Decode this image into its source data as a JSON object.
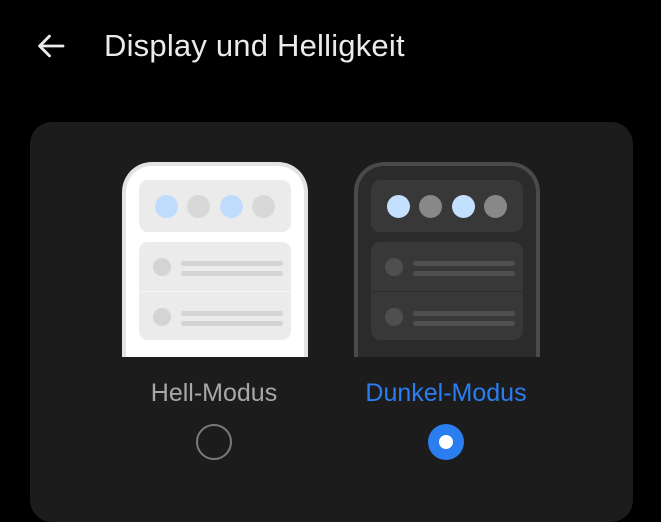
{
  "header": {
    "title": "Display und Helligkeit",
    "back_icon": "arrow-left-icon"
  },
  "theme_options": [
    {
      "label": "Hell-Modus",
      "selected": false,
      "preview": "light"
    },
    {
      "label": "Dunkel-Modus",
      "selected": true,
      "preview": "dark"
    }
  ],
  "colors": {
    "background": "#000000",
    "card": "#1c1c1c",
    "title_text": "#ebebeb",
    "accent": "#2a7ef0",
    "unselected_label": "#a8a8a8",
    "preview_light_dot_accent": "#bfdcfd",
    "preview_light_dot_muted": "#d8d8d8",
    "preview_dark_dot_accent": "#c4e0ff",
    "preview_dark_dot_muted": "#888888"
  }
}
